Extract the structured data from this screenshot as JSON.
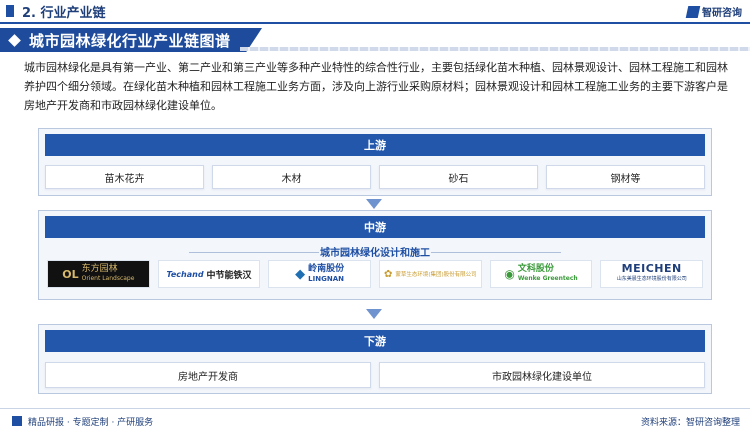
{
  "section": "2. 行业产业链",
  "brand": "智研咨询",
  "title": "城市园林绿化行业产业链图谱",
  "description": "城市园林绿化是具有第一产业、第二产业和第三产业等多种产业特性的综合性行业，主要包括绿化苗木种植、园林景观设计、园林工程施工和园林养护四个细分领域。在绿化苗木种植和园林工程施工业务方面，涉及向上游行业采购原材料；园林景观设计和园林工程施工业务的主要下游客户是房地产开发商和市政园林绿化建设单位。",
  "upstream": {
    "label": "上游",
    "items": [
      "苗木花卉",
      "木材",
      "砂石",
      "钢材等"
    ]
  },
  "midstream": {
    "label": "中游",
    "subtitle": "城市园林绿化设计和施工",
    "logos": [
      {
        "name": "东方园林",
        "sub": "Orient Landscape",
        "mark": "OL",
        "color": "#b8860b"
      },
      {
        "name": "中节能铁汉",
        "sub": "Techand",
        "mark": "T",
        "color": "#1f4fa3"
      },
      {
        "name": "岭南股份",
        "sub": "LINGNAN",
        "mark": "◆",
        "color": "#1f6fb3"
      },
      {
        "name": "蒙草生态环境(集团)股份有限公司",
        "sub": "",
        "mark": "✿",
        "color": "#c99a2e"
      },
      {
        "name": "文科股份",
        "sub": "Wenke Greentech",
        "mark": "◉",
        "color": "#3a9a3a"
      },
      {
        "name": "MEICHEN",
        "sub": "山东美晨生态环境股份有限公司",
        "mark": "",
        "color": "#1f3f7a"
      }
    ]
  },
  "downstream": {
    "label": "下游",
    "items": [
      "房地产开发商",
      "市政园林绿化建设单位"
    ]
  },
  "footer": {
    "left": "精品研报 · 专题定制 · 产研服务",
    "source": "资料来源：智研咨询整理"
  },
  "colors": {
    "primary": "#2357ac",
    "dark": "#1f3f7a"
  }
}
